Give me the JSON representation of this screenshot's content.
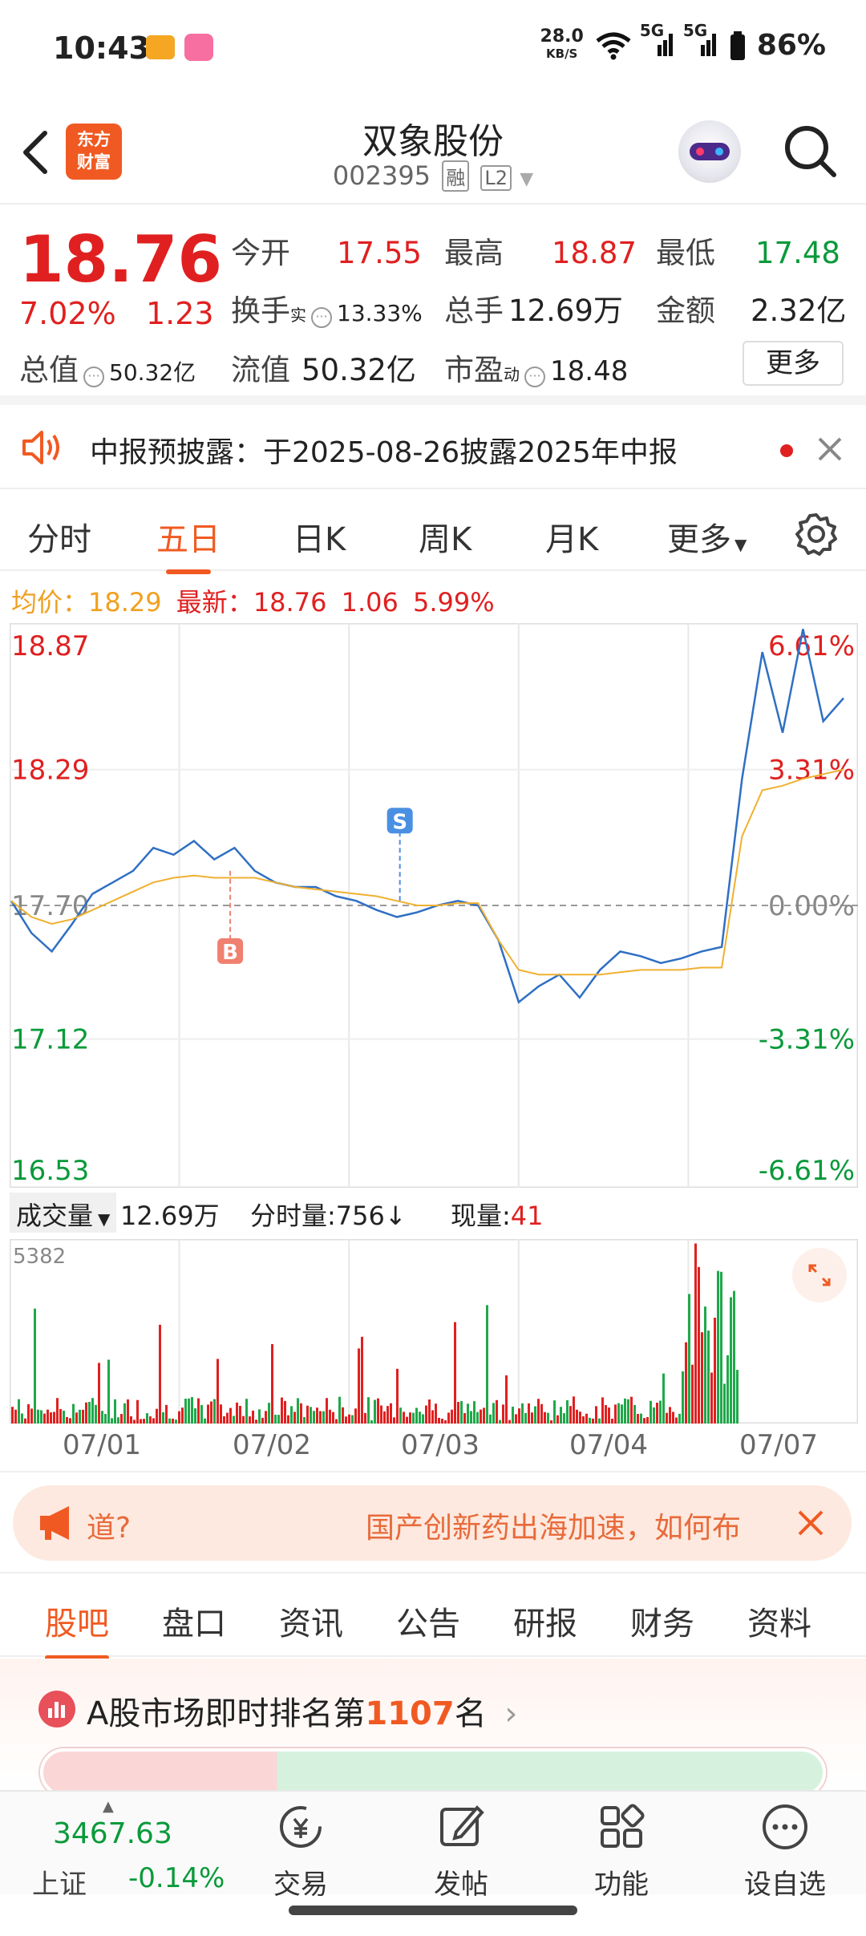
{
  "status_bar": {
    "time": "10:43",
    "net_speed": "28.0",
    "net_unit": "KB/S",
    "signal1": "5G",
    "signal2": "5G",
    "battery": "86%"
  },
  "header": {
    "logo_text": "东方财富",
    "stock_name": "双象股份",
    "stock_code": "002395",
    "tag1": "融",
    "tag2": "L2"
  },
  "quote": {
    "price": "18.76",
    "change_pct": "7.02%",
    "change_amt": "1.23",
    "open_label": "今开",
    "open": "17.55",
    "high_label": "最高",
    "high": "18.87",
    "low_label": "最低",
    "low": "17.48",
    "turnover_label": "换手",
    "turnover_sup": "实",
    "turnover": "13.33%",
    "volume_label": "总手",
    "volume": "12.69万",
    "amount_label": "金额",
    "amount": "2.32亿",
    "mktcap_label": "总值",
    "mktcap": "50.32亿",
    "float_label": "流值",
    "float": "50.32亿",
    "pe_label": "市盈",
    "pe_sup": "动",
    "pe": "18.48",
    "more_label": "更多"
  },
  "notice": {
    "text": "中报预披露：于2025-08-26披露2025年中报"
  },
  "chart_tabs": [
    "分时",
    "五日",
    "日K",
    "周K",
    "月K",
    "更多"
  ],
  "chart_tab_active": 1,
  "avg_line": {
    "avg_label": "均价：",
    "avg": "18.29",
    "latest_label": "最新：",
    "latest": "18.76",
    "chg": "1.06",
    "chg_pct": "5.99%"
  },
  "chart_data": {
    "type": "line",
    "title": "",
    "x": [
      "07/01",
      "07/02",
      "07/03",
      "07/04",
      "07/07"
    ],
    "ylim": [
      16.53,
      18.87
    ],
    "y_ticks_left": [
      "18.87",
      "18.29",
      "17.70",
      "17.12",
      "16.53"
    ],
    "y_ticks_right": [
      "6.61%",
      "3.31%",
      "0.00%",
      "-3.31%",
      "-6.61%"
    ],
    "prev_close": 17.7,
    "series": [
      {
        "values": [
          17.72,
          17.58,
          17.5,
          17.62,
          17.75,
          17.8,
          17.85,
          17.95,
          17.92,
          17.98,
          17.9,
          17.95,
          17.85,
          17.8,
          17.78,
          17.78,
          17.74,
          17.72,
          17.68,
          17.65,
          17.67,
          17.7,
          17.72,
          17.7,
          17.55,
          17.28,
          17.35,
          17.4,
          17.3,
          17.42,
          17.5,
          17.48,
          17.45,
          17.47,
          17.5,
          17.52,
          18.25,
          18.8,
          18.45,
          18.9,
          18.5,
          18.6
        ]
      },
      {
        "values": [
          17.72,
          17.65,
          17.62,
          17.64,
          17.68,
          17.72,
          17.76,
          17.8,
          17.82,
          17.83,
          17.82,
          17.82,
          17.82,
          17.8,
          17.78,
          17.77,
          17.76,
          17.75,
          17.74,
          17.72,
          17.7,
          17.7,
          17.71,
          17.71,
          17.55,
          17.42,
          17.4,
          17.4,
          17.4,
          17.4,
          17.41,
          17.42,
          17.42,
          17.42,
          17.43,
          17.43,
          18.0,
          18.2,
          18.22,
          18.25,
          18.27,
          18.29
        ]
      }
    ],
    "markers": [
      {
        "label": "B",
        "x_day": 1,
        "value": 17.85
      },
      {
        "label": "S",
        "x_day": 2,
        "value": 17.72
      }
    ]
  },
  "volume": {
    "sel_label": "成交量",
    "total": "12.69万",
    "tick_label": "分时量:",
    "tick": "756",
    "cur_label": "现量:",
    "cur": "41",
    "max": "5382"
  },
  "banner": {
    "left_text": "道?",
    "right_text": "国产创新药出海加速，如何布"
  },
  "bottom_tabs": [
    "股吧",
    "盘口",
    "资讯",
    "公告",
    "研报",
    "财务",
    "资料"
  ],
  "bottom_tab_active": 0,
  "rank": {
    "prefix": "A股市场即时排名第",
    "num": "1107",
    "suffix": "名"
  },
  "nav": {
    "index_value": "3467.63",
    "index_name": "上证",
    "index_chg": "-0.14%",
    "items": [
      "交易",
      "发帖",
      "功能",
      "设自选"
    ]
  }
}
